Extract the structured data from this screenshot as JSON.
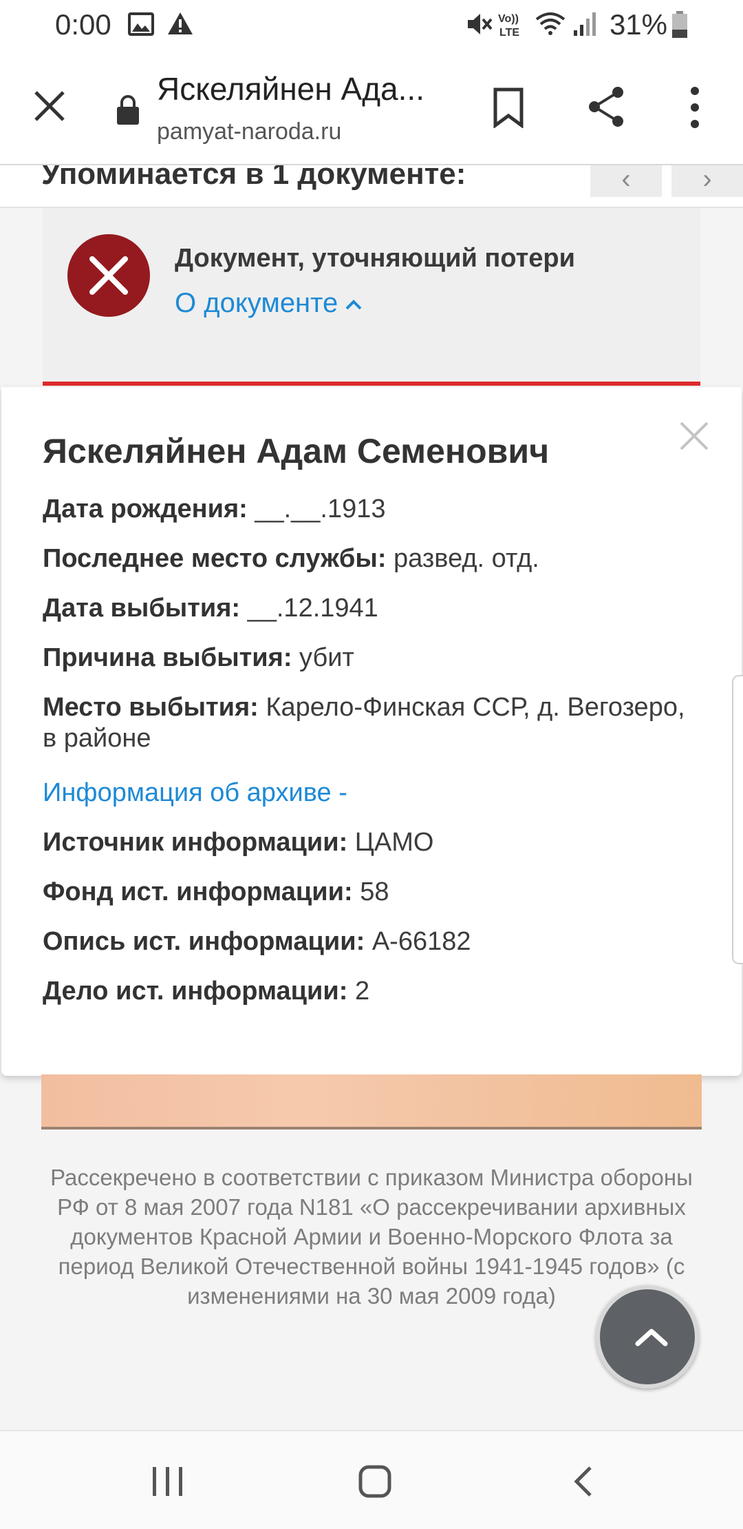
{
  "status_bar": {
    "time": "0:00",
    "battery_text": "31%",
    "icons": [
      "image-icon",
      "warning-icon",
      "mute-icon",
      "volte-icon",
      "wifi-icon",
      "signal-icon",
      "battery-icon"
    ]
  },
  "toolbar": {
    "title": "Яскеляйнен Ада...",
    "url": "pamyat-naroda.ru"
  },
  "mentions": {
    "text": "Упоминается в 1 документе:",
    "prev_label": "‹",
    "next_label": "›"
  },
  "document": {
    "title": "Документ, уточняющий потери",
    "link_label": "О документе",
    "accent_color": "#e02b2b",
    "icon_color": "#941a1f"
  },
  "person": {
    "name": "Яскеляйнен Адам Семенович",
    "fields": [
      {
        "label": "Дата рождения:",
        "value": "__.__.1913"
      },
      {
        "label": "Последнее место службы:",
        "value": "развед. отд."
      },
      {
        "label": "Дата выбытия:",
        "value": "__.12.1941"
      },
      {
        "label": "Причина выбытия:",
        "value": "убит"
      },
      {
        "label": "Место выбытия:",
        "value": "Карело-Финская ССР, д. Вегозеро, в районе"
      }
    ],
    "archive_link": "Информация об архиве -",
    "archive_fields": [
      {
        "label": "Источник информации:",
        "value": "ЦАМО"
      },
      {
        "label": "Фонд ист. информации:",
        "value": "58"
      },
      {
        "label": "Опись ист. информации:",
        "value": "А-66182"
      },
      {
        "label": "Дело ист. информации:",
        "value": "2"
      }
    ]
  },
  "footer": {
    "declassified_text": "Рассекречено в соответствии с приказом Министра обороны РФ от 8 мая 2007 года N181 «О рассекречивании архивных документов Красной Армии и Военно-Морского Флота за период Великой Отечественной войны 1941-1945 годов» (с изменениями на 30 мая 2009 года)"
  },
  "colors": {
    "link": "#1e8ad6",
    "fab": "#5e6266"
  }
}
